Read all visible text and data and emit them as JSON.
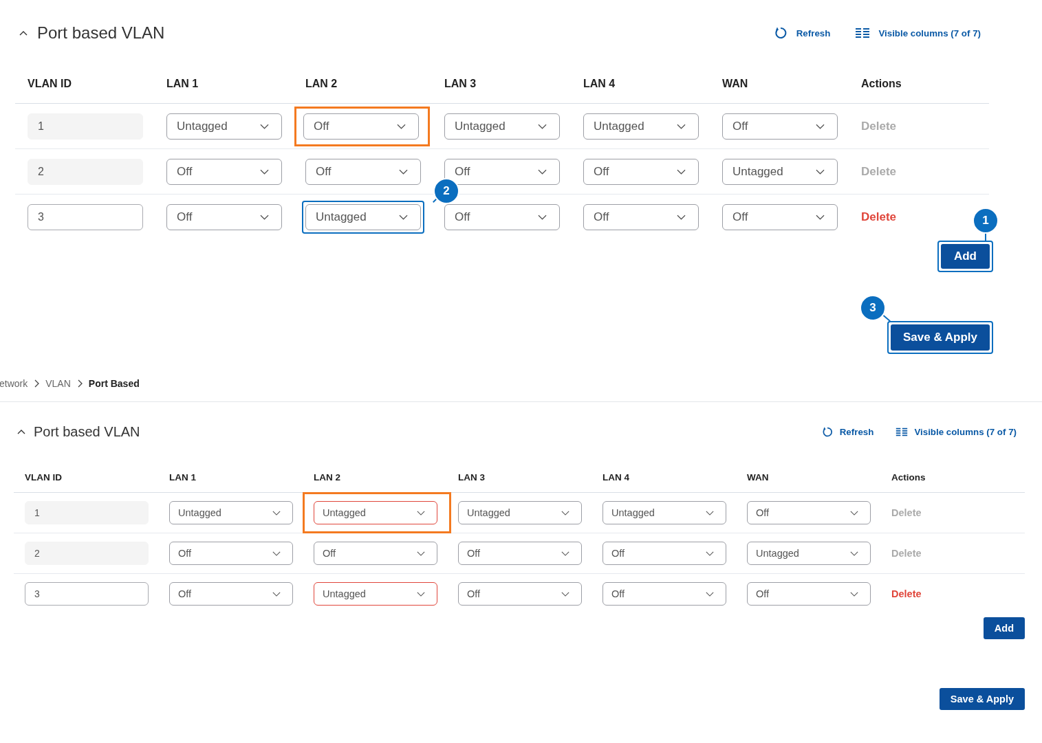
{
  "panels": [
    {
      "title": "Port based VLAN",
      "expanded": true,
      "refresh": "Refresh",
      "columns_button": "Visible columns (7 of 7)",
      "columns": [
        "VLAN ID",
        "LAN 1",
        "LAN 2",
        "LAN 3",
        "LAN 4",
        "WAN",
        "Actions"
      ],
      "rows": [
        {
          "vlan_id": "1",
          "id_disabled": true,
          "ports": [
            {
              "value": "Untagged",
              "highlighted": false,
              "focused": false,
              "invalid": false
            },
            {
              "value": "Off",
              "highlighted": true,
              "focused": false,
              "invalid": false
            },
            {
              "value": "Untagged",
              "highlighted": false,
              "focused": false,
              "invalid": false
            },
            {
              "value": "Untagged",
              "highlighted": false,
              "focused": false,
              "invalid": false
            },
            {
              "value": "Off",
              "highlighted": false,
              "focused": false,
              "invalid": false
            }
          ],
          "delete": "Delete",
          "delete_disabled": true
        },
        {
          "vlan_id": "2",
          "id_disabled": true,
          "ports": [
            {
              "value": "Off",
              "highlighted": false,
              "focused": false,
              "invalid": false
            },
            {
              "value": "Off",
              "highlighted": false,
              "focused": false,
              "invalid": false
            },
            {
              "value": "Off",
              "highlighted": false,
              "focused": false,
              "invalid": false
            },
            {
              "value": "Off",
              "highlighted": false,
              "focused": false,
              "invalid": false
            },
            {
              "value": "Untagged",
              "highlighted": false,
              "focused": false,
              "invalid": false
            }
          ],
          "delete": "Delete",
          "delete_disabled": true
        },
        {
          "vlan_id": "3",
          "id_disabled": false,
          "ports": [
            {
              "value": "Off",
              "highlighted": false,
              "focused": false,
              "invalid": false
            },
            {
              "value": "Untagged",
              "highlighted": false,
              "focused": true,
              "invalid": false,
              "callout": "2"
            },
            {
              "value": "Off",
              "highlighted": false,
              "focused": false,
              "invalid": false
            },
            {
              "value": "Off",
              "highlighted": false,
              "focused": false,
              "invalid": false
            },
            {
              "value": "Off",
              "highlighted": false,
              "focused": false,
              "invalid": false
            }
          ],
          "delete": "Delete",
          "delete_disabled": false
        }
      ],
      "add": {
        "label": "Add",
        "callout": "1"
      },
      "save": {
        "label": "Save & Apply",
        "callout": "3"
      }
    },
    {
      "breadcrumb": [
        {
          "label": "etwork",
          "current": false
        },
        {
          "label": "VLAN",
          "current": false
        },
        {
          "label": "Port Based",
          "current": true
        }
      ],
      "title": "Port based VLAN",
      "expanded": true,
      "refresh": "Refresh",
      "columns_button": "Visible columns (7 of 7)",
      "columns": [
        "VLAN ID",
        "LAN 1",
        "LAN 2",
        "LAN 3",
        "LAN 4",
        "WAN",
        "Actions"
      ],
      "rows": [
        {
          "vlan_id": "1",
          "id_disabled": true,
          "ports": [
            {
              "value": "Untagged",
              "highlighted": false,
              "focused": false,
              "invalid": false
            },
            {
              "value": "Untagged",
              "highlighted": true,
              "focused": false,
              "invalid": true
            },
            {
              "value": "Untagged",
              "highlighted": false,
              "focused": false,
              "invalid": false
            },
            {
              "value": "Untagged",
              "highlighted": false,
              "focused": false,
              "invalid": false
            },
            {
              "value": "Off",
              "highlighted": false,
              "focused": false,
              "invalid": false
            }
          ],
          "delete": "Delete",
          "delete_disabled": true
        },
        {
          "vlan_id": "2",
          "id_disabled": true,
          "ports": [
            {
              "value": "Off",
              "highlighted": false,
              "focused": false,
              "invalid": false
            },
            {
              "value": "Off",
              "highlighted": false,
              "focused": false,
              "invalid": false
            },
            {
              "value": "Off",
              "highlighted": false,
              "focused": false,
              "invalid": false
            },
            {
              "value": "Off",
              "highlighted": false,
              "focused": false,
              "invalid": false
            },
            {
              "value": "Untagged",
              "highlighted": false,
              "focused": false,
              "invalid": false
            }
          ],
          "delete": "Delete",
          "delete_disabled": true
        },
        {
          "vlan_id": "3",
          "id_disabled": false,
          "ports": [
            {
              "value": "Off",
              "highlighted": false,
              "focused": false,
              "invalid": false
            },
            {
              "value": "Untagged",
              "highlighted": false,
              "focused": false,
              "invalid": true
            },
            {
              "value": "Off",
              "highlighted": false,
              "focused": false,
              "invalid": false
            },
            {
              "value": "Off",
              "highlighted": false,
              "focused": false,
              "invalid": false
            },
            {
              "value": "Off",
              "highlighted": false,
              "focused": false,
              "invalid": false
            }
          ],
          "delete": "Delete",
          "delete_disabled": false
        }
      ],
      "add": {
        "label": "Add"
      },
      "save": {
        "label": "Save & Apply"
      }
    }
  ]
}
